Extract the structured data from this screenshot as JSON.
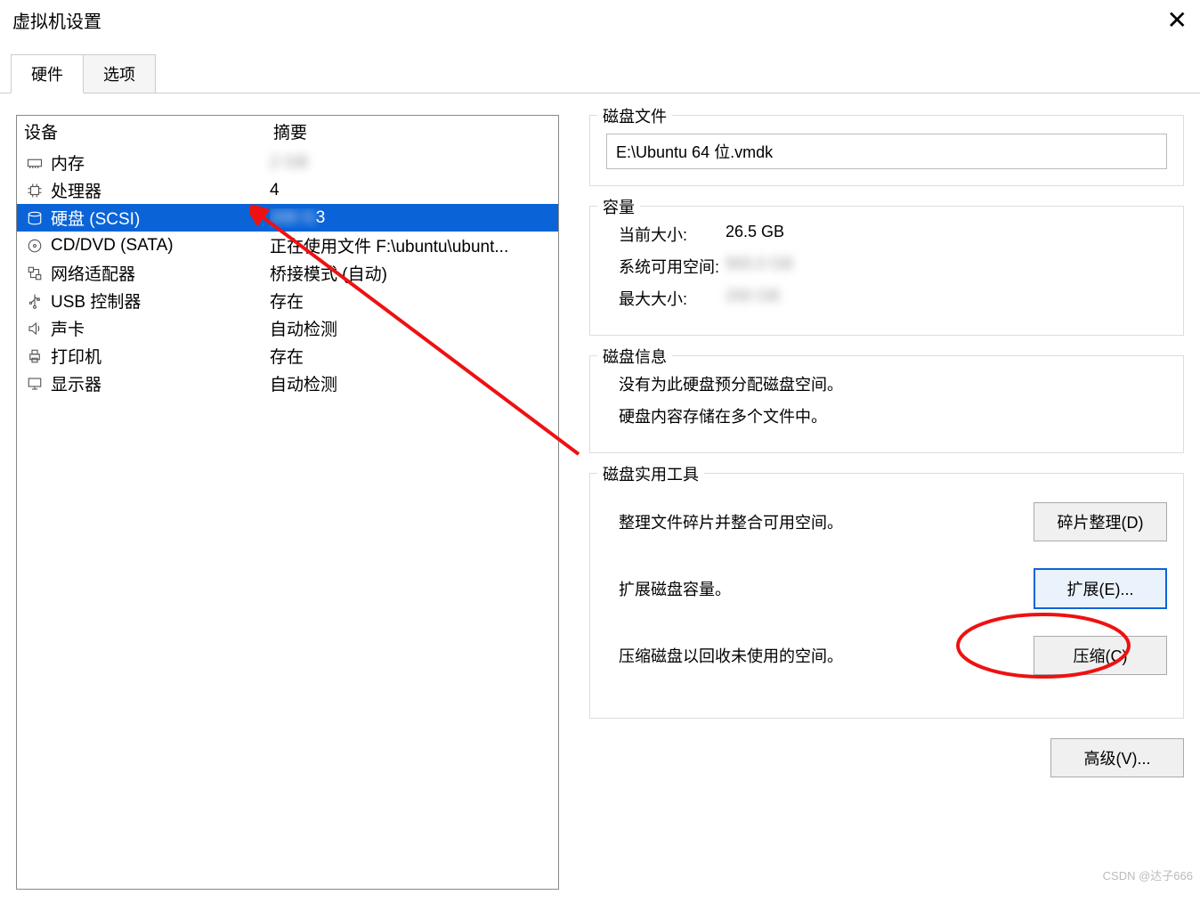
{
  "window": {
    "title": "虚拟机设置"
  },
  "tabs": {
    "hardware": "硬件",
    "options": "选项"
  },
  "device_table": {
    "header_device": "设备",
    "header_summary": "摘要",
    "rows": [
      {
        "icon": "memory-icon",
        "name": "内存",
        "summary": ""
      },
      {
        "icon": "cpu-icon",
        "name": "处理器",
        "summary": "4"
      },
      {
        "icon": "disk-icon",
        "name": "硬盘 (SCSI)",
        "summary": "3",
        "selected": true
      },
      {
        "icon": "cd-icon",
        "name": "CD/DVD (SATA)",
        "summary": "正在使用文件 F:\\ubuntu\\ubunt..."
      },
      {
        "icon": "network-icon",
        "name": "网络适配器",
        "summary": "桥接模式 (自动)"
      },
      {
        "icon": "usb-icon",
        "name": "USB 控制器",
        "summary": "存在"
      },
      {
        "icon": "sound-icon",
        "name": "声卡",
        "summary": "自动检测"
      },
      {
        "icon": "printer-icon",
        "name": "打印机",
        "summary": "存在"
      },
      {
        "icon": "display-icon",
        "name": "显示器",
        "summary": "自动检测"
      }
    ]
  },
  "disk_file": {
    "title": "磁盘文件",
    "path": "E:\\Ubuntu 64 位.vmdk"
  },
  "capacity": {
    "title": "容量",
    "current_label": "当前大小:",
    "current_value": "26.5 GB",
    "free_label": "系统可用空间:",
    "free_value": "",
    "max_label": "最大大小:",
    "max_value": ""
  },
  "disk_info": {
    "title": "磁盘信息",
    "line1": "没有为此硬盘预分配磁盘空间。",
    "line2": "硬盘内容存储在多个文件中。"
  },
  "disk_util": {
    "title": "磁盘实用工具",
    "defrag_desc": "整理文件碎片并整合可用空间。",
    "defrag_btn": "碎片整理(D)",
    "expand_desc": "扩展磁盘容量。",
    "expand_btn": "扩展(E)...",
    "compact_desc": "压缩磁盘以回收未使用的空间。",
    "compact_btn": "压缩(C)"
  },
  "advanced_btn": "高级(V)...",
  "watermark": "CSDN @达子666"
}
